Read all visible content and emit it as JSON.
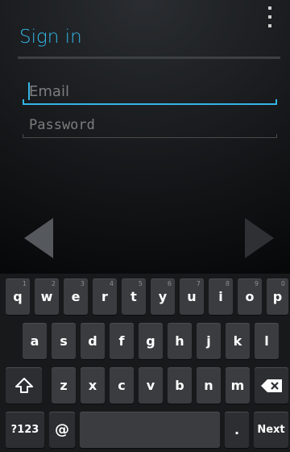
{
  "header": {
    "title": "Sign in"
  },
  "form": {
    "email_placeholder": "Email",
    "password_placeholder": "Password"
  },
  "colors": {
    "accent": "#33b5e5",
    "key_bg": "#3a3c3f",
    "keyboard_bg": "#18191b"
  },
  "keyboard": {
    "row1": [
      {
        "label": "q",
        "hint": "1"
      },
      {
        "label": "w",
        "hint": "2"
      },
      {
        "label": "e",
        "hint": "3"
      },
      {
        "label": "r",
        "hint": "4"
      },
      {
        "label": "t",
        "hint": "5"
      },
      {
        "label": "y",
        "hint": "6"
      },
      {
        "label": "u",
        "hint": "7"
      },
      {
        "label": "i",
        "hint": "8"
      },
      {
        "label": "o",
        "hint": "9"
      },
      {
        "label": "p",
        "hint": "0"
      }
    ],
    "row2": [
      "a",
      "s",
      "d",
      "f",
      "g",
      "h",
      "j",
      "k",
      "l"
    ],
    "row3": [
      "z",
      "x",
      "c",
      "v",
      "b",
      "n",
      "m"
    ],
    "symbols_label": "?123",
    "at_label": "@",
    "period_label": ".",
    "next_label": "Next",
    "shift_icon": "shift-icon",
    "backspace_icon": "backspace-icon"
  }
}
